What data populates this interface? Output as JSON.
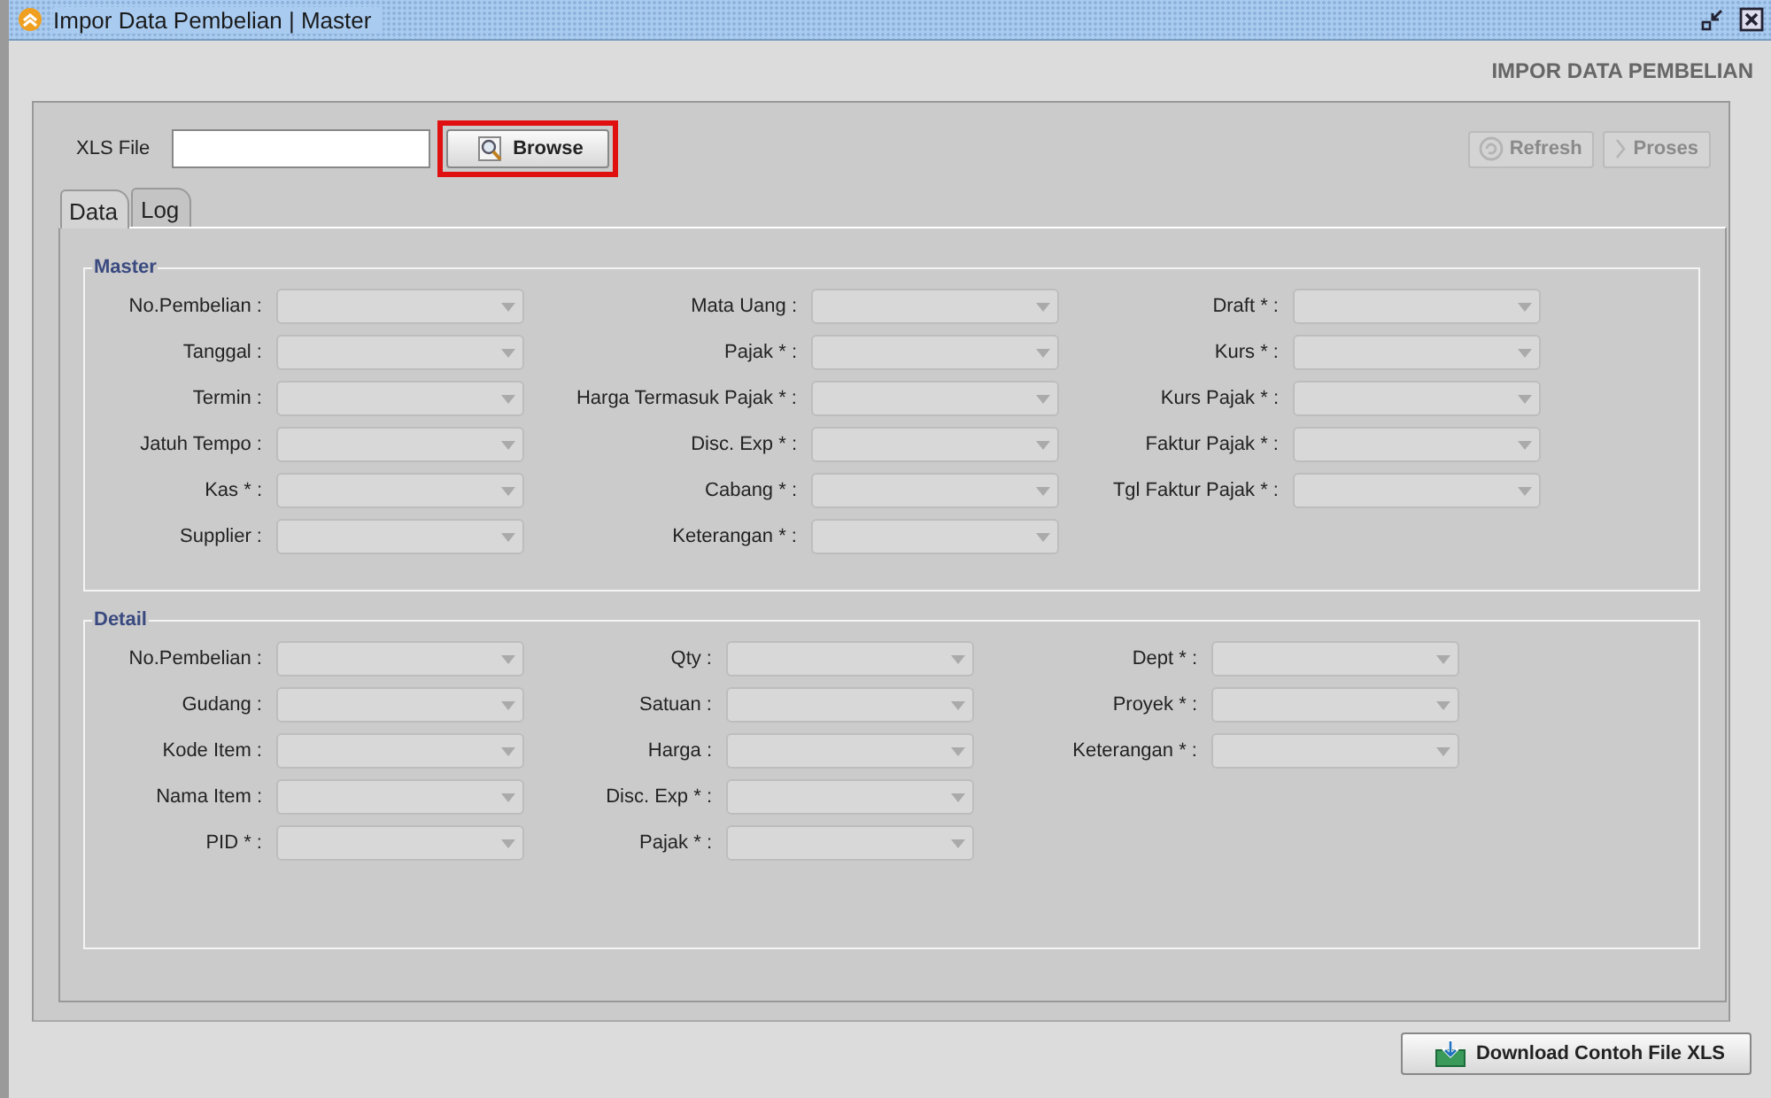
{
  "window": {
    "title": "Impor Data Pembelian | Master"
  },
  "heading": "IMPOR DATA PEMBELIAN",
  "file": {
    "label": "XLS File",
    "button": {
      "label": "Browse",
      "disabled": false,
      "highlighted": true
    }
  },
  "actions": [
    {
      "label": "Refresh",
      "kind": "refresh",
      "disabled": true
    },
    {
      "label": "Proses",
      "kind": "proceed",
      "disabled": true
    }
  ],
  "tabs": [
    {
      "label": "Data",
      "selected": true
    },
    {
      "label": "Log",
      "selected": false
    }
  ],
  "groups": [
    {
      "title": "Master",
      "columns": [
        [
          {
            "label": "No.Pembelian :",
            "disabled": true
          },
          {
            "label": "Tanggal :",
            "disabled": true
          },
          {
            "label": "Termin :",
            "disabled": true
          },
          {
            "label": "Jatuh Tempo :",
            "disabled": true
          },
          {
            "label": "Kas * :",
            "disabled": true
          },
          {
            "label": "Supplier :",
            "disabled": true
          }
        ],
        [
          {
            "label": "Mata Uang :",
            "disabled": true
          },
          {
            "label": "Pajak * :",
            "disabled": true
          },
          {
            "label": "Harga Termasuk Pajak * :",
            "disabled": true
          },
          {
            "label": "Disc. Exp * :",
            "disabled": true
          },
          {
            "label": "Cabang * :",
            "disabled": true
          },
          {
            "label": "Keterangan * :",
            "disabled": true
          }
        ],
        [
          {
            "label": "Draft * :",
            "disabled": true
          },
          {
            "label": "Kurs * :",
            "disabled": true
          },
          {
            "label": "Kurs Pajak * :",
            "disabled": true
          },
          {
            "label": "Faktur Pajak * :",
            "disabled": true
          },
          {
            "label": "Tgl Faktur Pajak * :",
            "disabled": true
          }
        ]
      ]
    },
    {
      "title": "Detail",
      "columns": [
        [
          {
            "label": "No.Pembelian :",
            "disabled": true
          },
          {
            "label": "Gudang :",
            "disabled": true
          },
          {
            "label": "Kode Item :",
            "disabled": true
          },
          {
            "label": "Nama Item :",
            "disabled": true
          },
          {
            "label": "PID * :",
            "disabled": true
          }
        ],
        [
          {
            "label": "Qty :",
            "disabled": true
          },
          {
            "label": "Satuan :",
            "disabled": true
          },
          {
            "label": "Harga :",
            "disabled": true
          },
          {
            "label": "Disc. Exp * :",
            "disabled": true
          },
          {
            "label": "Pajak * :",
            "disabled": true
          }
        ],
        [
          {
            "label": "Dept * :",
            "disabled": true
          },
          {
            "label": "Proyek * :",
            "disabled": true
          },
          {
            "label": "Keterangan * :",
            "disabled": true
          }
        ]
      ]
    }
  ],
  "download_button": {
    "label": "Download Contoh File XLS",
    "disabled": false
  }
}
